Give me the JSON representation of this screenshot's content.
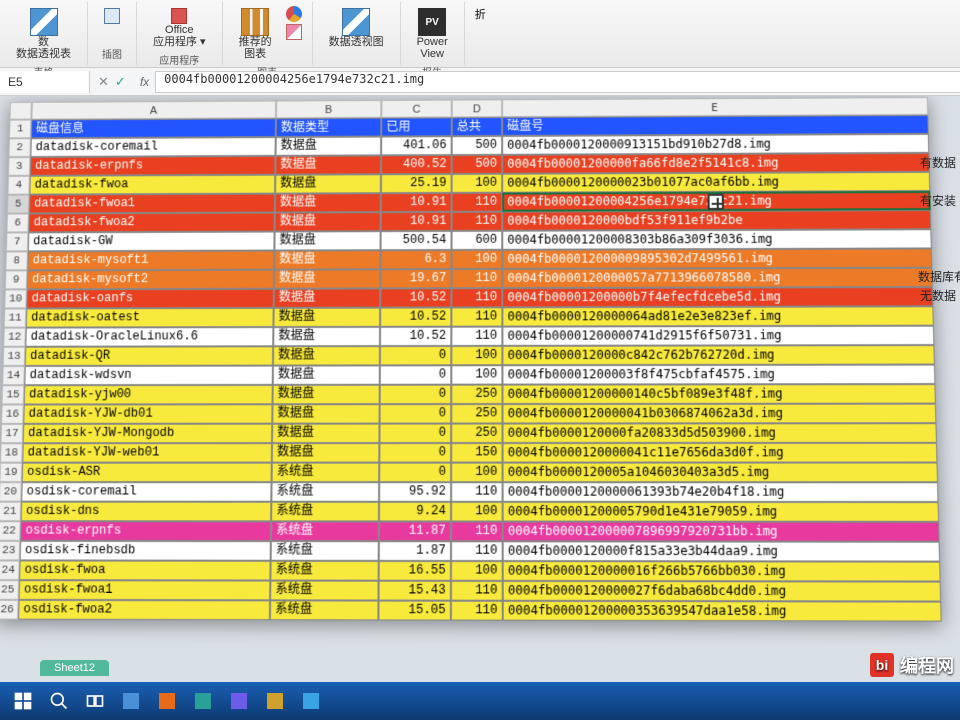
{
  "ribbon": {
    "groups": {
      "tables_label": "表格",
      "pivot_off": "数",
      "pivot_label": "数据透视表",
      "illustrations_label": "插图",
      "apps_small": "Office\n应用程序 ▾",
      "apps_label": "应用程序",
      "recomm_chart": "推荐的\n图表",
      "charts_label": "图表",
      "pivotchart_label": "数据透视图",
      "powerview_label": "Power\nView",
      "reports_label": "报告",
      "fold_label": "折"
    }
  },
  "namebox": "E5",
  "formula": "0004fb00001200004256e1794e732c21.img",
  "columns": [
    "A",
    "B",
    "C",
    "D",
    "E"
  ],
  "header": {
    "a": "磁盘信息",
    "b": "数据类型",
    "c": "已用",
    "d": "总共",
    "e": "磁盘号"
  },
  "notes": {
    "r3": "有数据",
    "r5": "有安装",
    "r9": "数据库有",
    "r10": "无数据"
  },
  "rows": [
    {
      "n": 2,
      "cls": "bg-white",
      "a": "datadisk-coremail",
      "b": "数据盘",
      "c": "401.06",
      "d": "500",
      "e": "0004fb0000120000913151bd910b27d8.img"
    },
    {
      "n": 3,
      "cls": "bg-red",
      "a": "datadisk-erpnfs",
      "b": "数据盘",
      "c": "400.52",
      "d": "500",
      "e": "0004fb00001200000fa66fd8e2f5141c8.img"
    },
    {
      "n": 4,
      "cls": "bg-yellow",
      "a": "datadisk-fwoa",
      "b": "数据盘",
      "c": "25.19",
      "d": "100",
      "e": "0004fb0000120000023b01077ac0af6bb.img"
    },
    {
      "n": 5,
      "cls": "bg-red",
      "a": "datadisk-fwoa1",
      "b": "数据盘",
      "c": "10.91",
      "d": "110",
      "e": "0004fb00001200004256e1794e732c21.img",
      "sel": true
    },
    {
      "n": 6,
      "cls": "bg-red",
      "a": "datadisk-fwoa2",
      "b": "数据盘",
      "c": "10.91",
      "d": "110",
      "e": "0004fb0000120000bdf53f911ef9b2be"
    },
    {
      "n": 7,
      "cls": "bg-white",
      "a": "datadisk-GW",
      "b": "数据盘",
      "c": "500.54",
      "d": "600",
      "e": "0004fb00001200008303b86a309f3036.img"
    },
    {
      "n": 8,
      "cls": "bg-orange",
      "a": "datadisk-mysoft1",
      "b": "数据盘",
      "c": "6.3",
      "d": "100",
      "e": "0004fb000012000009895302d7499561.img"
    },
    {
      "n": 9,
      "cls": "bg-orange",
      "a": "datadisk-mysoft2",
      "b": "数据盘",
      "c": "19.67",
      "d": "110",
      "e": "0004fb0000120000057a7713966078580.img"
    },
    {
      "n": 10,
      "cls": "bg-red",
      "a": "datadisk-oanfs",
      "b": "数据盘",
      "c": "10.52",
      "d": "110",
      "e": "0004fb00001200000b7f4efecfdcebe5d.img"
    },
    {
      "n": 11,
      "cls": "bg-yellow",
      "a": "datadisk-oatest",
      "b": "数据盘",
      "c": "10.52",
      "d": "110",
      "e": "0004fb0000120000064ad81e2e3e823ef.img"
    },
    {
      "n": 12,
      "cls": "bg-white",
      "a": "datadisk-OracleLinux6.6",
      "b": "数据盘",
      "c": "10.52",
      "d": "110",
      "e": "0004fb00001200000741d2915f6f50731.img"
    },
    {
      "n": 13,
      "cls": "bg-yellow",
      "a": "datadisk-QR",
      "b": "数据盘",
      "c": "0",
      "d": "100",
      "e": "0004fb0000120000c842c762b762720d.img"
    },
    {
      "n": 14,
      "cls": "bg-white",
      "a": "datadisk-wdsvn",
      "b": "数据盘",
      "c": "0",
      "d": "100",
      "e": "0004fb00001200003f8f475cbfaf4575.img"
    },
    {
      "n": 15,
      "cls": "bg-yellow",
      "a": "datadisk-yjw00",
      "b": "数据盘",
      "c": "0",
      "d": "250",
      "e": "0004fb00001200000140c5bf089e3f48f.img"
    },
    {
      "n": 16,
      "cls": "bg-yellow",
      "a": "datadisk-YJW-db01",
      "b": "数据盘",
      "c": "0",
      "d": "250",
      "e": "0004fb0000120000041b0306874062a3d.img"
    },
    {
      "n": 17,
      "cls": "bg-yellow",
      "a": "datadisk-YJW-Mongodb",
      "b": "数据盘",
      "c": "0",
      "d": "250",
      "e": "0004fb0000120000fa20833d5d503900.img"
    },
    {
      "n": 18,
      "cls": "bg-yellow",
      "a": "datadisk-YJW-web01",
      "b": "数据盘",
      "c": "0",
      "d": "150",
      "e": "0004fb0000120000041c11e7656da3d0f.img"
    },
    {
      "n": 19,
      "cls": "bg-yellow",
      "a": "osdisk-ASR",
      "b": "系统盘",
      "c": "0",
      "d": "100",
      "e": "0004fb0000120005a1046030403a3d5.img"
    },
    {
      "n": 20,
      "cls": "bg-white",
      "a": "osdisk-coremail",
      "b": "系统盘",
      "c": "95.92",
      "d": "110",
      "e": "0004fb0000120000061393b74e20b4f18.img"
    },
    {
      "n": 21,
      "cls": "bg-yellow",
      "a": "osdisk-dns",
      "b": "系统盘",
      "c": "9.24",
      "d": "100",
      "e": "0004fb00001200005790d1e431e79059.img"
    },
    {
      "n": 22,
      "cls": "bg-pink",
      "a": "osdisk-erpnfs",
      "b": "系统盘",
      "c": "11.87",
      "d": "110",
      "e": "0004fb000012000007896997920731bb.img"
    },
    {
      "n": 23,
      "cls": "bg-white",
      "a": "osdisk-finebsdb",
      "b": "系统盘",
      "c": "1.87",
      "d": "110",
      "e": "0004fb0000120000f815a33e3b44daa9.img"
    },
    {
      "n": 24,
      "cls": "bg-yellow",
      "a": "osdisk-fwoa",
      "b": "系统盘",
      "c": "16.55",
      "d": "100",
      "e": "0004fb0000120000016f266b5766bb030.img"
    },
    {
      "n": 25,
      "cls": "bg-yellow",
      "a": "osdisk-fwoa1",
      "b": "系统盘",
      "c": "15.43",
      "d": "110",
      "e": "0004fb0000120000027f6daba68bc4dd0.img"
    },
    {
      "n": 26,
      "cls": "bg-yellow",
      "a": "osdisk-fwoa2",
      "b": "系统盘",
      "c": "15.05",
      "d": "110",
      "e": "0004fb00001200000353639547daa1e58.img"
    }
  ],
  "sheet_tab": "Sheet12",
  "watermark": "编程网"
}
